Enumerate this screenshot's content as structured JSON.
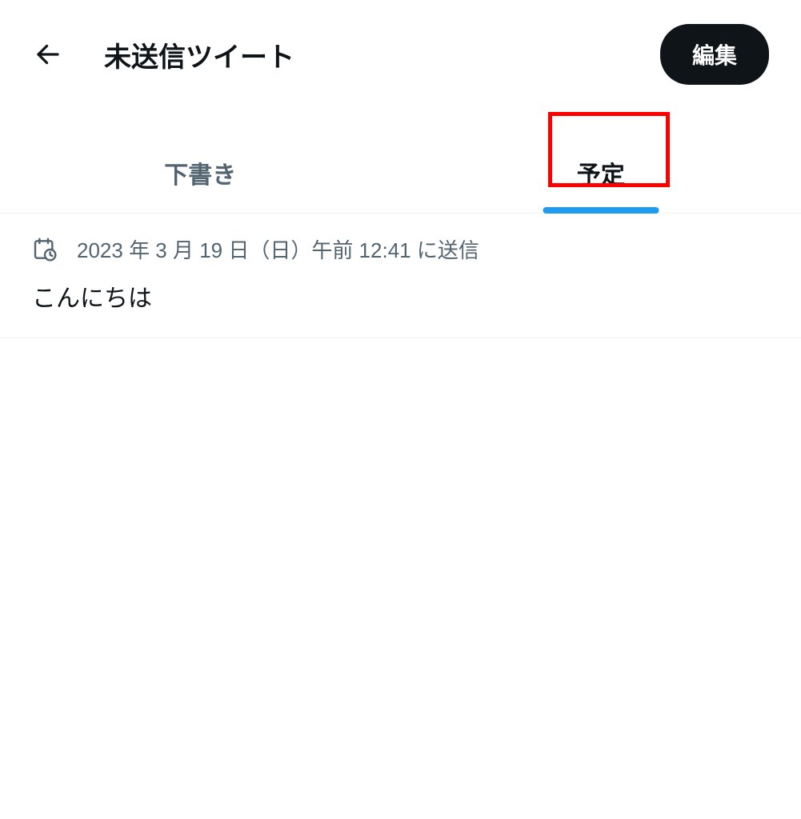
{
  "header": {
    "title": "未送信ツイート",
    "edit_label": "編集"
  },
  "tabs": {
    "drafts_label": "下書き",
    "scheduled_label": "予定",
    "active": "scheduled"
  },
  "scheduled_items": [
    {
      "time_text": "2023 年 3 月 19 日（日）午前 12:41 に送信",
      "content": "こんにちは"
    }
  ]
}
